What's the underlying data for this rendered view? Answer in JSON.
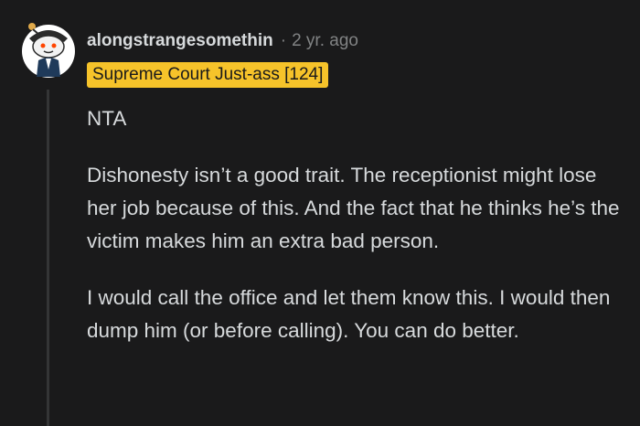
{
  "comment": {
    "username": "alongstrangesomethin",
    "separator": "·",
    "time": "2 yr. ago",
    "flair": "Supreme Court Just-ass [124]",
    "paragraphs": [
      "NTA",
      "Dishonesty isn’t a good trait. The receptionist might lose her job because of this. And the fact that he thinks he’s the victim makes him an extra bad person.",
      "I would call the office and let them know this. I would then dump him (or before calling). You can do better."
    ]
  },
  "icons": {
    "avatar": "snoo-avatar-icon"
  },
  "colors": {
    "background": "#1a1a1b",
    "text": "#d7dadc",
    "muted": "#818384",
    "flair_bg": "#f6c32a"
  }
}
